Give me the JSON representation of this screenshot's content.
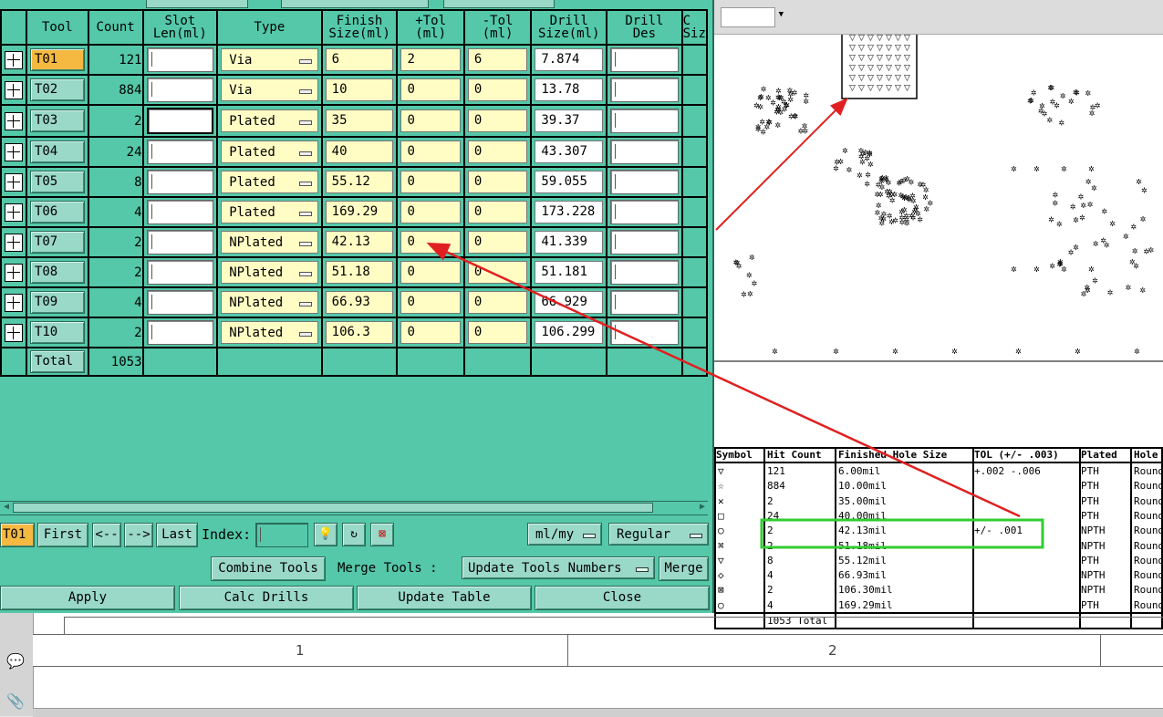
{
  "grid": {
    "headers": {
      "tool": "Tool",
      "count": "Count",
      "slot_len": "Slot\nLen(ml)",
      "type": "Type",
      "finish_size": "Finish\nSize(ml)",
      "plus_tol": "+Tol\n(ml)",
      "minus_tol": "-Tol\n(ml)",
      "drill_size": "Drill\nSize(ml)",
      "drill_des": "Drill\nDes",
      "extra": "C\nSiz"
    },
    "rows": [
      {
        "tool": "T01",
        "count": "121",
        "type": "Via",
        "finish": "6",
        "ptol": "2",
        "mtol": "6",
        "drill": "7.874"
      },
      {
        "tool": "T02",
        "count": "884",
        "type": "Via",
        "finish": "10",
        "ptol": "0",
        "mtol": "0",
        "drill": "13.78"
      },
      {
        "tool": "T03",
        "count": "2",
        "type": "Plated",
        "finish": "35",
        "ptol": "0",
        "mtol": "0",
        "drill": "39.37"
      },
      {
        "tool": "T04",
        "count": "24",
        "type": "Plated",
        "finish": "40",
        "ptol": "0",
        "mtol": "0",
        "drill": "43.307"
      },
      {
        "tool": "T05",
        "count": "8",
        "type": "Plated",
        "finish": "55.12",
        "ptol": "0",
        "mtol": "0",
        "drill": "59.055"
      },
      {
        "tool": "T06",
        "count": "4",
        "type": "Plated",
        "finish": "169.29",
        "ptol": "0",
        "mtol": "0",
        "drill": "173.228"
      },
      {
        "tool": "T07",
        "count": "2",
        "type": "NPlated",
        "finish": "42.13",
        "ptol": "0",
        "mtol": "0",
        "drill": "41.339"
      },
      {
        "tool": "T08",
        "count": "2",
        "type": "NPlated",
        "finish": "51.18",
        "ptol": "0",
        "mtol": "0",
        "drill": "51.181"
      },
      {
        "tool": "T09",
        "count": "4",
        "type": "NPlated",
        "finish": "66.93",
        "ptol": "0",
        "mtol": "0",
        "drill": "66.929"
      },
      {
        "tool": "T10",
        "count": "2",
        "type": "NPlated",
        "finish": "106.3",
        "ptol": "0",
        "mtol": "0",
        "drill": "106.299"
      }
    ],
    "total_label": "Total",
    "total_count": "1053"
  },
  "nav": {
    "current_tool": "T01",
    "first": "First",
    "prev": "<--",
    "next": "-->",
    "last": "Last",
    "index_label": "Index:",
    "units": "ml/my",
    "mode": "Regular"
  },
  "merge_row": {
    "combine": "Combine Tools",
    "merge_tools_label": "Merge Tools :",
    "merge_option": "Update Tools Numbers",
    "merge": "Merge"
  },
  "actions": {
    "apply": "Apply",
    "calc": "Calc Drills",
    "update": "Update Table",
    "close": "Close"
  },
  "legend": {
    "headers": [
      "Symbol",
      "Hit Count",
      "Finished Hole Size",
      "TOL (+/- .003)",
      "Plated",
      "Hole"
    ],
    "rows": [
      {
        "sym": "▽",
        "count": "121",
        "size": "6.00mil",
        "tol": "+.002 -.006",
        "plated": "PTH",
        "hole": "Round"
      },
      {
        "sym": "☆",
        "count": "884",
        "size": "10.00mil",
        "tol": "",
        "plated": "PTH",
        "hole": "Round"
      },
      {
        "sym": "✕",
        "count": "2",
        "size": "35.00mil",
        "tol": "",
        "plated": "PTH",
        "hole": "Round"
      },
      {
        "sym": "□",
        "count": "24",
        "size": "40.00mil",
        "tol": "",
        "plated": "PTH",
        "hole": "Round"
      },
      {
        "sym": "○",
        "count": "2",
        "size": "42.13mil",
        "tol": "+/- .001",
        "plated": "NPTH",
        "hole": "Round"
      },
      {
        "sym": "⌘",
        "count": "2",
        "size": "51.18mil",
        "tol": "",
        "plated": "NPTH",
        "hole": "Round"
      },
      {
        "sym": "▽",
        "count": "8",
        "size": "55.12mil",
        "tol": "",
        "plated": "PTH",
        "hole": "Round"
      },
      {
        "sym": "◇",
        "count": "4",
        "size": "66.93mil",
        "tol": "",
        "plated": "NPTH",
        "hole": "Round"
      },
      {
        "sym": "⊠",
        "count": "2",
        "size": "106.30mil",
        "tol": "",
        "plated": "NPTH",
        "hole": "Round"
      },
      {
        "sym": "○",
        "count": "4",
        "size": "169.29mil",
        "tol": "",
        "plated": "PTH",
        "hole": "Round"
      }
    ],
    "total": "1053 Total"
  },
  "ruler": {
    "col1": "1",
    "col2": "2"
  },
  "icons": {
    "row_toggle": "plus-grid-icon",
    "comment": "comment-icon",
    "attach": "paperclip-icon",
    "lightbulb": "lightbulb-icon",
    "refresh": "refresh-icon",
    "delete": "delete-icon"
  },
  "colors": {
    "dialog_bg": "#54c8a8",
    "button_bg": "#9ad8c8",
    "active_tool": "#f5b942",
    "yellow_field": "#fffdc4",
    "highlight_box": "#33cc33",
    "arrow": "#e02020"
  }
}
